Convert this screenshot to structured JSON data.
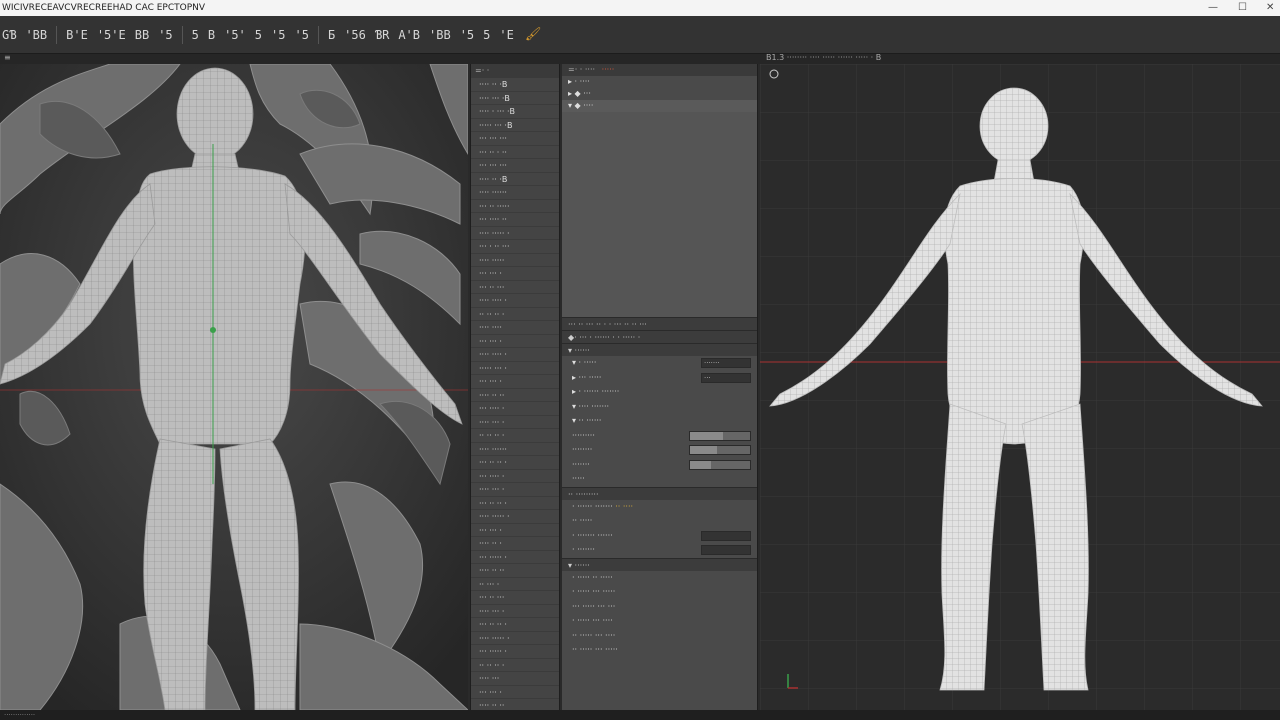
{
  "window": {
    "title": "WICIVRECEAVCVRECREEHAD CAC EPCTOPNV",
    "controls": [
      "—",
      "☐",
      "✕"
    ]
  },
  "toolbar": {
    "buttons": [
      "GƁ",
      "'BB",
      "B'E",
      "'5'E",
      "BB",
      "'5",
      "5",
      "B",
      "'5'",
      "5",
      "'5",
      "'5",
      "Ƃ",
      "'56",
      "ƁR",
      "A'B",
      "'BB",
      "'5",
      "5",
      "'E"
    ],
    "action_icon": "paint-brush-icon"
  },
  "strip": {
    "left_label": "≡",
    "right_label": "B1.3  ········  ···· ·····  ······ ·····  ·  B"
  },
  "outliner": {
    "header": "=· ·",
    "items": [
      "···· ·· ·B",
      "···· ···  ·B",
      "···· · ···  ·B",
      "····· ···  ·B",
      "··· ··· ···",
      "··· ·· · ··",
      "··· ··· ···",
      "···· ··  ·B",
      "···· ······",
      "··· ·· ·····",
      "··· ···· ··",
      "···· ····· ·",
      "··· · ·· ···",
      "···· ·····",
      "··· ··· ·",
      "··· ·· ···",
      "···· ···· ·",
      "·· ·· ·· ·",
      "···· ····",
      "··· ··· ·",
      "···· ···· ·",
      "····· ··· ·",
      "··· ··· ·",
      "···· ·· ··",
      "··· ···· ·",
      "···· ··· ·",
      "·· ·· ·· ·",
      "···· ······",
      "··· ·· ·· ·",
      "··· ···· ·",
      "···· ··· ·",
      "··· ·· ·· ·",
      "···· ····· ·",
      "··· ··· ·",
      "···· ·· ·",
      "··· ····· ·",
      "···· ·· ··",
      "·· ··· ·",
      "··· ·· ···",
      "···· ··· ·",
      "··· ·· ·· ·",
      "···· ····· ·",
      "··· ····· ·",
      "·· ·· ·· ·",
      "···· ···",
      "··· ··· ·",
      "···· ·· ··"
    ]
  },
  "properties": {
    "header_left": "=· ·  ····",
    "header_highlight": "·····",
    "tree": [
      "▸ ·  ····",
      "▸  ◆  ···",
      "▾  ◆  ····"
    ],
    "section1": "··· ·· ···  ·· · ·  ··· ··  ·· ···",
    "section1b": "◆· ··· ·  ······ · ·  ····· ·",
    "section2": "▾  ······",
    "rows": [
      {
        "label": "▾ ·  ·····",
        "field": "·······"
      },
      {
        "label": "▸  ···  ·····",
        "field": "···"
      },
      {
        "label": "▸  ·  ······  ·······",
        "field": ""
      },
      {
        "label": "▾  ···· ·······",
        "field": ""
      },
      {
        "label": "▾  ·· ······",
        "field": ""
      },
      {
        "label": "·········",
        "bar": 0.55
      },
      {
        "label": "········",
        "bar": 0.45
      },
      {
        "label": "·······",
        "bar": 0.35
      },
      {
        "label": "·····",
        "field": ""
      }
    ],
    "section3": "·· ·········",
    "rows2": [
      {
        "label": "· ······ ·······",
        "value": "·· ····"
      },
      {
        "label": "··  ·····",
        "field": ""
      },
      {
        "label": "·  ·······  ······",
        "field": ""
      },
      {
        "label": "·  ·······",
        "field": ""
      }
    ],
    "section4": "▾  ······",
    "rows3": [
      "· ·····  ··  ·····",
      "·  ·····  ···  ·····",
      "··· ·····  ···  ···",
      "·  ·····  ···  ····",
      "··  ·····  ···  ····",
      "··  ·····  ···  ·····"
    ]
  },
  "status": {
    "text": "··············"
  },
  "colors": {
    "accent": "#e05a3a",
    "highlight": "#e0b33a",
    "grid": "#3a3a3a",
    "axis_red": "#a83232",
    "axis_green": "#3aa04a"
  }
}
